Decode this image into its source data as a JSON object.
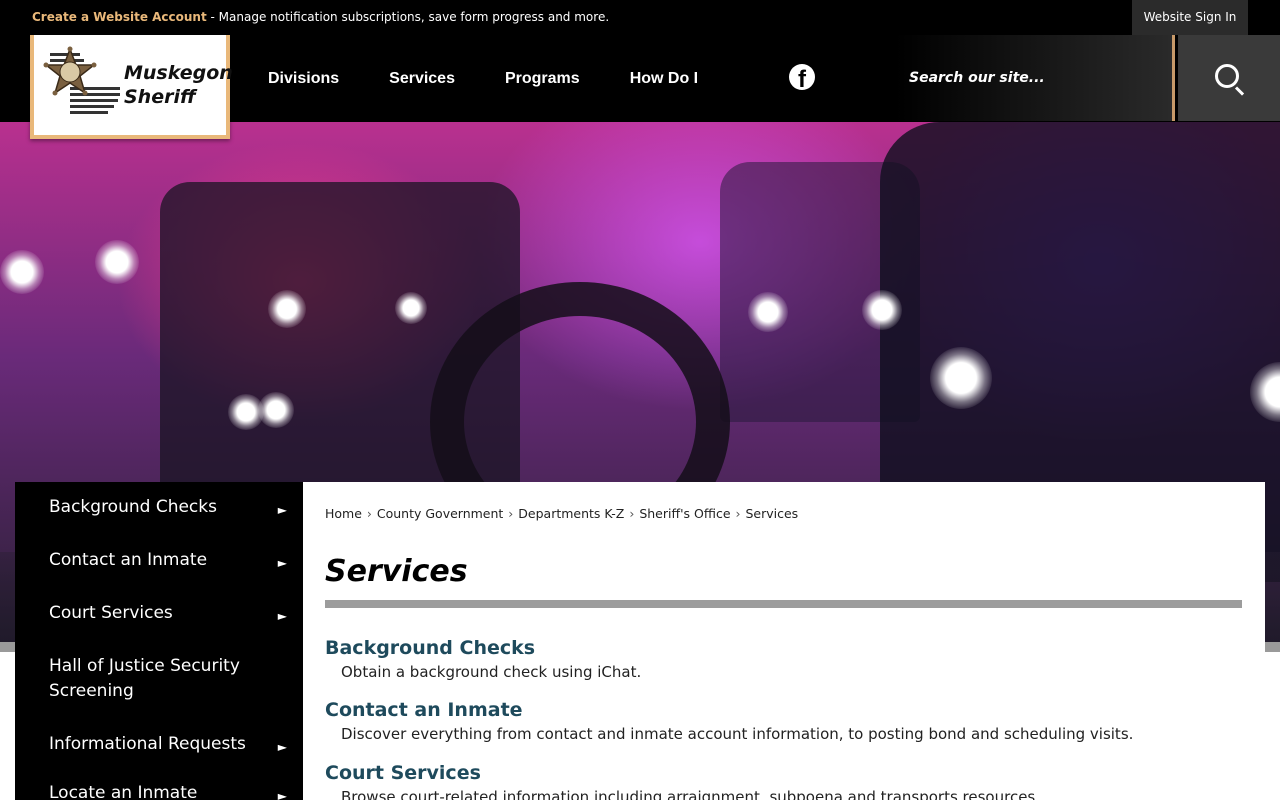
{
  "topbar": {
    "create_account": "Create a Website Account",
    "notice": " - Manage notification subscriptions, save form progress and more.",
    "sign_in": "Website Sign In"
  },
  "logo": {
    "line1": "Muskegon",
    "line2": "Sheriff"
  },
  "nav": {
    "items": [
      "Divisions",
      "Services",
      "Programs",
      "How Do I"
    ]
  },
  "search": {
    "placeholder": "Search our site..."
  },
  "sidenav": {
    "items": [
      "Background Checks",
      "Contact an Inmate",
      "Court Services",
      "Hall of Justice Security Screening",
      "Informational Requests",
      "Locate an Inmate"
    ]
  },
  "breadcrumb": [
    "Home",
    "County Government",
    "Departments K-Z",
    "Sheriff's Office",
    "Services"
  ],
  "page": {
    "title": "Services",
    "services": [
      {
        "title": "Background Checks",
        "desc": "Obtain a background check using iChat."
      },
      {
        "title": "Contact an Inmate",
        "desc": "Discover everything from contact and inmate account information, to posting bond and scheduling visits."
      },
      {
        "title": "Court Services",
        "desc": "Browse court-related information including arraignment, subpoena and transports resources."
      }
    ]
  },
  "colors": {
    "accent": "#e9b87a",
    "link": "#1e4a5c",
    "header": "#000000"
  }
}
